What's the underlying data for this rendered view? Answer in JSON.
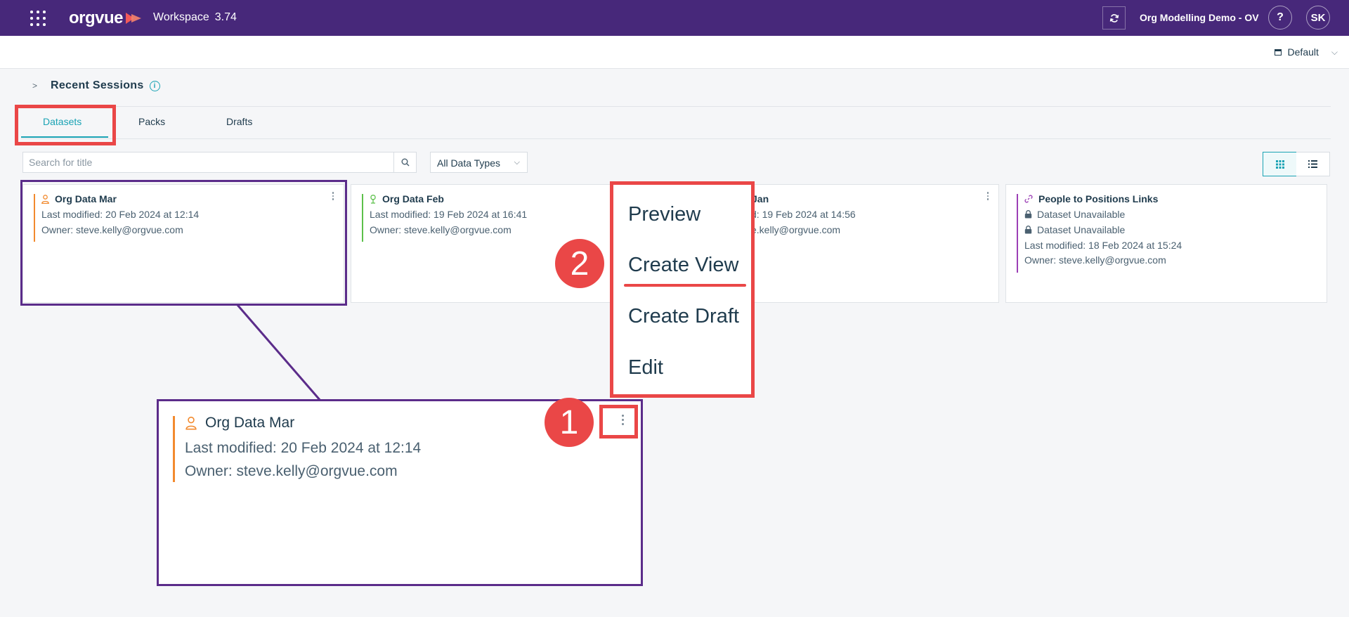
{
  "topbar": {
    "logo_text": "orgvue",
    "workspace_label": "Workspace",
    "version": "3.74",
    "org_name": "Org Modelling Demo - OV",
    "help_label": "?",
    "avatar_initials": "SK",
    "bg_color": "#47287a"
  },
  "subbar": {
    "default_label": "Default"
  },
  "recent_sessions": {
    "title": "Recent Sessions",
    "info_label": "i"
  },
  "tabs": [
    {
      "label": "Datasets",
      "active": true
    },
    {
      "label": "Packs",
      "active": false
    },
    {
      "label": "Drafts",
      "active": false
    }
  ],
  "toolbar": {
    "search_placeholder": "Search for title",
    "type_filter": "All Data Types"
  },
  "cards": [
    {
      "title": "Org Data Mar",
      "icon": "person-icon",
      "accent": "#f28a2e",
      "modified": "Last modified: 20 Feb 2024 at 12:14",
      "owner": "Owner: steve.kelly@orgvue.com"
    },
    {
      "title": "Org Data Feb",
      "icon": "position-icon",
      "accent": "#5cc04a",
      "modified": "Last modified: 19 Feb 2024 at 16:41",
      "owner": "Owner: steve.kelly@orgvue.com"
    },
    {
      "title": "Jan",
      "modified": "d: 19 Feb 2024 at 14:56",
      "owner": "e.kelly@orgvue.com"
    },
    {
      "title": "People to Positions Links",
      "icon": "link-icon",
      "accent": "#9b3fb5",
      "unavailable_1": "Dataset Unavailable",
      "unavailable_2": "Dataset Unavailable",
      "modified": "Last modified: 18 Feb 2024 at 15:24",
      "owner": "Owner: steve.kelly@orgvue.com"
    }
  ],
  "context_menu": {
    "items": [
      "Preview",
      "Create View",
      "Create Draft",
      "Edit"
    ],
    "highlighted": "Create View"
  },
  "callouts": {
    "badge_1": "1",
    "badge_2": "2",
    "annotation_red": "#ea4747",
    "annotation_purple": "#5b2c8a"
  },
  "zoom_card": {
    "title": "Org Data Mar",
    "modified": "Last modified: 20 Feb 2024 at 12:14",
    "owner": "Owner: steve.kelly@orgvue.com"
  }
}
